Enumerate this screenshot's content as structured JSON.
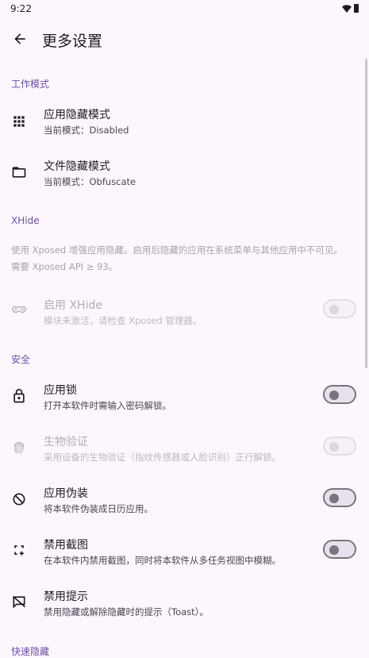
{
  "status_bar": {
    "time": "9:22"
  },
  "app_bar": {
    "title": "更多设置"
  },
  "sections": {
    "work_mode": "工作模式",
    "xhide": "XHide",
    "security": "安全",
    "quick_hide": "快速隐藏"
  },
  "xhide_desc": {
    "line1": "使用 Xposed 增强应用隐藏。启用后隐藏的应用在系统菜单与其他应用中不可见。",
    "line2": "需要 Xposed API ≥ 93。"
  },
  "settings": {
    "app_hide_mode": {
      "title": "应用隐藏模式",
      "subtitle": "当前模式：Disabled",
      "icon": "grid-icon"
    },
    "file_hide_mode": {
      "title": "文件隐藏模式",
      "subtitle": "当前模式：Obfuscate",
      "icon": "folder-icon"
    },
    "enable_xhide": {
      "title": "启用 XHide",
      "subtitle": "模块未激活，请检查 Xposed 管理器。",
      "icon": "mask-icon",
      "enabled": false,
      "checked": false
    },
    "app_lock": {
      "title": "应用锁",
      "subtitle": "打开本软件时需输入密码解锁。",
      "icon": "lock-icon",
      "enabled": true,
      "checked": false
    },
    "biometric": {
      "title": "生物验证",
      "subtitle": "采用设备的生物验证（指纹传感器或人脸识别）正行解锁。",
      "icon": "fingerprint-icon",
      "enabled": false,
      "checked": false
    },
    "app_disguise": {
      "title": "应用伪装",
      "subtitle": "将本软件伪装成日历应用。",
      "icon": "visibility-off-icon",
      "enabled": true,
      "checked": false
    },
    "disable_screenshot": {
      "title": "禁用截图",
      "subtitle": "在本软件内禁用截图，同时将本软件从多任务视图中模糊。",
      "icon": "screenshot-icon",
      "enabled": true,
      "checked": false
    },
    "disable_toast": {
      "title": "禁用提示",
      "subtitle": "禁用隐藏或解除隐藏时的提示（Toast）。",
      "icon": "comment-off-icon"
    }
  }
}
